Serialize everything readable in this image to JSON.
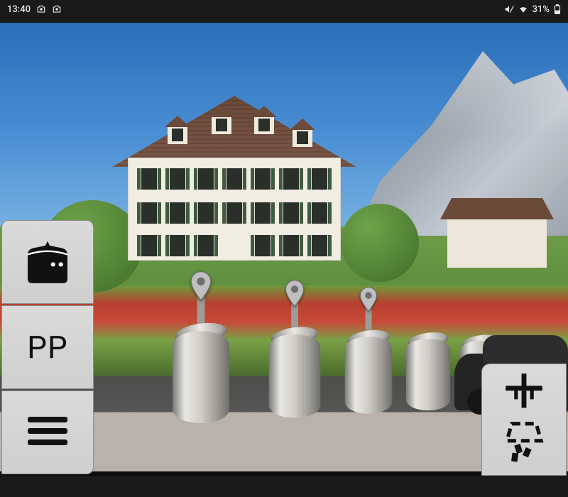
{
  "status_bar": {
    "time": "13:40",
    "battery_text": "31%"
  },
  "side_panel": {
    "pp_label": "PP"
  },
  "icons": {
    "container": "container-icon",
    "menu": "menu-icon",
    "crane_dump": "crane-dump-icon",
    "map_pin": "map-pin-icon"
  }
}
